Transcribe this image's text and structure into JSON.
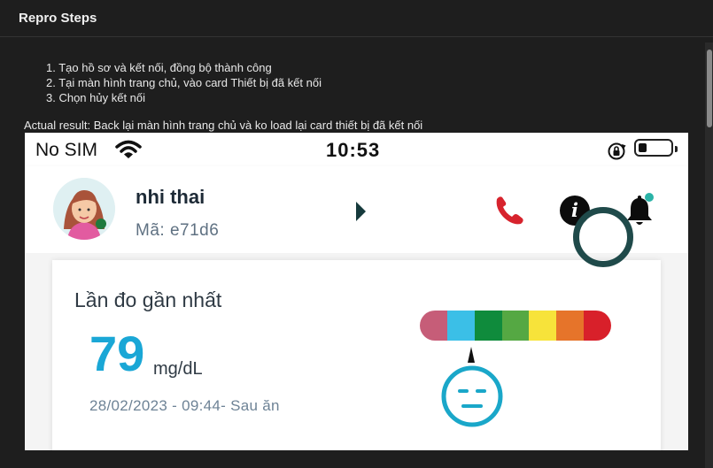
{
  "header": {
    "title": "Repro Steps"
  },
  "steps": [
    "1. Tạo hồ sơ và kết nối, đồng bộ thành công",
    "2. Tại màn hình trang chủ, vào card Thiết bị đã kết nối",
    "3. Chọn hủy kết nối"
  ],
  "actual_result": "Actual result: Back lại màn hình trang chủ và ko load lại card thiết bị đã kết nối",
  "phone": {
    "status_bar": {
      "carrier": "No SIM",
      "time": "10:53"
    },
    "profile": {
      "name": "nhi thai",
      "code": "Mã: e71d6",
      "icons": [
        "avatar",
        "chevron-right-icon",
        "phone-icon",
        "info-icon",
        "bell-icon"
      ]
    },
    "card": {
      "label": "Lần đo gần nhất",
      "value": "79",
      "unit": "mg/dL",
      "datetime": "28/02/2023 - 09:44- Sau ăn",
      "scale_colors": [
        "#c65d78",
        "#3bbfe7",
        "#0f8b3c",
        "#55a843",
        "#f7e33a",
        "#e6742a",
        "#d8202a"
      ],
      "face_color": "#1aa7c9"
    }
  }
}
